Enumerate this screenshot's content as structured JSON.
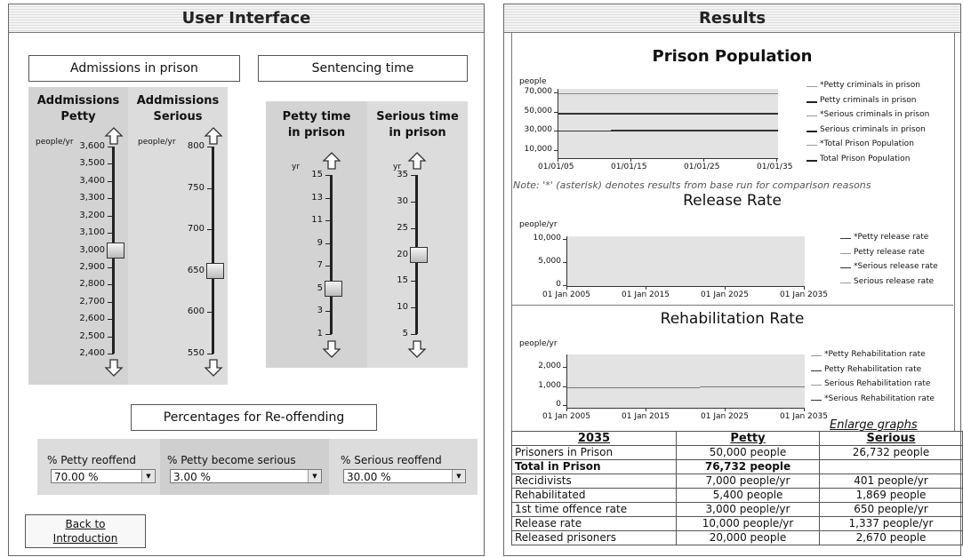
{
  "ui": {
    "title": "User Interface",
    "admissions_header": "Admissions in prison",
    "sentencing_header": "Sentencing time",
    "sliders": [
      {
        "title_line1": "Addmissions",
        "title_line2": "Petty",
        "unit": "people/yr",
        "ticks": [
          "3,600",
          "3,500",
          "3,400",
          "3,300",
          "3,200",
          "3,100",
          "3,000",
          "2,900",
          "2,800",
          "2,700",
          "2,600",
          "2,500",
          "2,400"
        ],
        "value": 3000
      },
      {
        "title_line1": "Addmissions",
        "title_line2": "Serious",
        "unit": "people/yr",
        "ticks": [
          "800",
          "750",
          "700",
          "650",
          "600",
          "550"
        ],
        "value": 650
      },
      {
        "title_line1": "Petty time",
        "title_line2": "in prison",
        "unit": "yr",
        "ticks": [
          "15",
          "13",
          "11",
          "9",
          "7",
          "5",
          "3",
          "1"
        ],
        "value": 5
      },
      {
        "title_line1": "Serious time",
        "title_line2": "in prison",
        "unit": "yr",
        "ticks": [
          "35",
          "30",
          "25",
          "20",
          "15",
          "10",
          "5"
        ],
        "value": 20
      }
    ],
    "reoffend_header": "Percentages for Re-offending",
    "reoffend": [
      {
        "label": "% Petty reoffend",
        "value": "70.00 %"
      },
      {
        "label": "% Petty become serious",
        "value": "3.00 %"
      },
      {
        "label": "% Serious reoffend",
        "value": "30.00 %"
      }
    ],
    "back_button_line1": "Back to",
    "back_button_line2": "Introduction"
  },
  "results": {
    "title": "Results",
    "prison_graph": {
      "title": "Prison Population",
      "unit": "people",
      "y_ticks": [
        "70,000",
        "50,000",
        "30,000",
        "10,000"
      ],
      "x_ticks": [
        "01/01/05",
        "01/01/15",
        "01/01/25",
        "01/01/35"
      ],
      "legend": [
        "*Petty criminals in prison",
        "Petty criminals in prison",
        "*Serious criminals in prison",
        "Serious criminals in prison",
        "*Total Prison Population",
        "Total Prison Population"
      ],
      "note": "Note: '*' (asterisk) denotes results from base run for comparison reasons"
    },
    "release_graph": {
      "title": "Release Rate",
      "unit": "people/yr",
      "y_ticks": [
        "10,000",
        "5,000",
        "0"
      ],
      "x_ticks": [
        "01 Jan 2005",
        "01 Jan 2015",
        "01 Jan 2025",
        "01 Jan 2035"
      ],
      "legend": [
        "*Petty release rate",
        "Petty release rate",
        "*Serious release rate",
        "Serious release rate"
      ]
    },
    "rehab_graph": {
      "title": "Rehabilitation Rate",
      "unit": "people/yr",
      "y_ticks": [
        "2,000",
        "1,000",
        "0"
      ],
      "x_ticks": [
        "01 Jan 2005",
        "01 Jan 2015",
        "01 Jan 2025",
        "01 Jan 2035"
      ],
      "legend": [
        "*Petty Rehabilitation rate",
        "Petty Rehabilitation rate",
        "Serious Rehabilitation rate",
        "*Serious Rehabilitation rate"
      ]
    },
    "enlarge_link": "Enlarge graphs",
    "table": {
      "headers": [
        "2035",
        "Petty",
        "Serious"
      ],
      "rows": [
        {
          "label": "Prisoners in Prison",
          "petty": "50,000 people",
          "serious": "26,732 people"
        },
        {
          "label": "Total in Prison",
          "petty": "76,732 people",
          "serious": ""
        },
        {
          "label": "Recidivists",
          "petty": "7,000 people/yr",
          "serious": "401 people/yr"
        },
        {
          "label": "Rehabilitated",
          "petty": "5,400 people",
          "serious": "1,869 people"
        },
        {
          "label": "1st time offence rate",
          "petty": "3,000 people/yr",
          "serious": "650 people/yr"
        },
        {
          "label": "Release rate",
          "petty": "10,000 people/yr",
          "serious": "1,337 people/yr"
        },
        {
          "label": "Released prisoners",
          "petty": "20,000 people",
          "serious": "2,670 people"
        }
      ]
    }
  }
}
